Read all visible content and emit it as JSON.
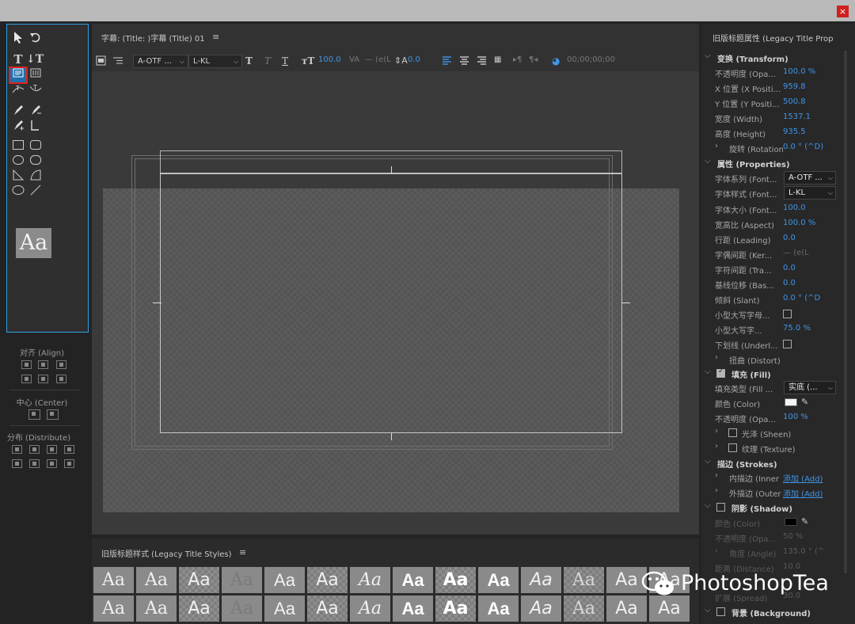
{
  "window": {
    "close_symbol": "×"
  },
  "tools": {
    "preview_text": "Aa"
  },
  "align": {
    "label": "对齐 (Align)",
    "center_label": "中心 (Center)",
    "distribute_label": "分布 (Distribute)"
  },
  "title_panel": {
    "title": "字幕: (Title: )字幕 (Title) 01",
    "menu_symbol": "≡",
    "font_family": "A-OTF ...",
    "font_style": "L-KL",
    "font_size": "100.0",
    "kerning": "— (e(L",
    "leading": "0.0",
    "timecode": "00;00;00;00"
  },
  "styles_panel": {
    "title": "旧版标题样式 (Legacy Title Styles)",
    "menu_symbol": "≡",
    "swatches_row1": [
      "Aa",
      "Aa",
      "Aa",
      "Aa",
      "Aa",
      "Aa",
      "Aa",
      "Aa",
      "Aa",
      "Aa",
      "Aa",
      "Aa",
      "Aa",
      "Aa"
    ],
    "swatches_row2": [
      "Aa",
      "Aa",
      "Aa",
      "Aa",
      "Aa",
      "Aa",
      "Aa",
      "Aa",
      "Aa",
      "Aa",
      "Aa",
      "Aa",
      "Aa",
      "Aa"
    ]
  },
  "props": {
    "title": "旧版标题属性 (Legacy Title Prop",
    "transform": "变换 (Transform)",
    "opacity_label": "不透明度 (Opa...",
    "opacity": "100.0 %",
    "xpos_label": "X 位置 (X Positi...",
    "xpos": "959.8",
    "ypos_label": "Y 位置 (Y Positi...",
    "ypos": "500.8",
    "width_label": "宽度 (Width)",
    "width": "1537.1",
    "height_label": "高度 (Height)",
    "height": "935.5",
    "rotation_label": "旋转 (Rotation)",
    "rotation": "0.0 ° (^D)",
    "properties": "属性 (Properties)",
    "font_family_label": "字体系列 (Font...",
    "font_family": "A-OTF ...",
    "font_style_label": "字体样式 (Font...",
    "font_style": "L-KL",
    "font_size_label": "字体大小 (Font...",
    "font_size": "100.0",
    "aspect_label": "宽高比 (Aspect)",
    "aspect": "100.0 %",
    "leading_label": "行距 (Leading)",
    "leading": "0.0",
    "kerning_label": "字偶间距 (Ker...",
    "kerning": "— (e(L",
    "tracking_label": "字符间距 (Tra...",
    "tracking": "0.0",
    "baseline_label": "基线位移 (Bas...",
    "baseline": "0.0",
    "slant_label": "倾斜 (Slant)",
    "slant": "0.0 ° (^D",
    "smallcaps_label": "小型大写字母...",
    "smallcaps_size_label": "小型大写字...",
    "smallcaps_size": "75.0 %",
    "underline_label": "下划线 (Underl...",
    "distort_label": "扭曲 (Distort)",
    "fill": "填充 (Fill)",
    "fill_type_label": "填充类型 (Fill ...",
    "fill_type": "实底 (...",
    "color_label": "颜色 (Color)",
    "fill_opacity_label": "不透明度 (Opa...",
    "fill_opacity": "100 %",
    "sheen_label": "光泽 (Sheen)",
    "texture_label": "纹理 (Texture)",
    "strokes": "描边 (Strokes)",
    "inner_label": "内描边 (Inner",
    "inner_add": "添加 (Add)",
    "outer_label": "外描边 (Outer",
    "outer_add": "添加 (Add)",
    "shadow": "阴影 (Shadow)",
    "shadow_color_label": "颜色 (Color)",
    "shadow_opacity_label": "不透明度 (Opa...",
    "shadow_opacity": "50 %",
    "angle_label": "角度 (Angle)",
    "angle": "135.0 ° (^",
    "distance_label": "距离 (Distance)",
    "distance": "10.0",
    "spread_label": "扩展 (Spread)",
    "spread": "30.0",
    "background": "背景 (Background)"
  },
  "watermark": {
    "text": "PhotoshopTea"
  }
}
